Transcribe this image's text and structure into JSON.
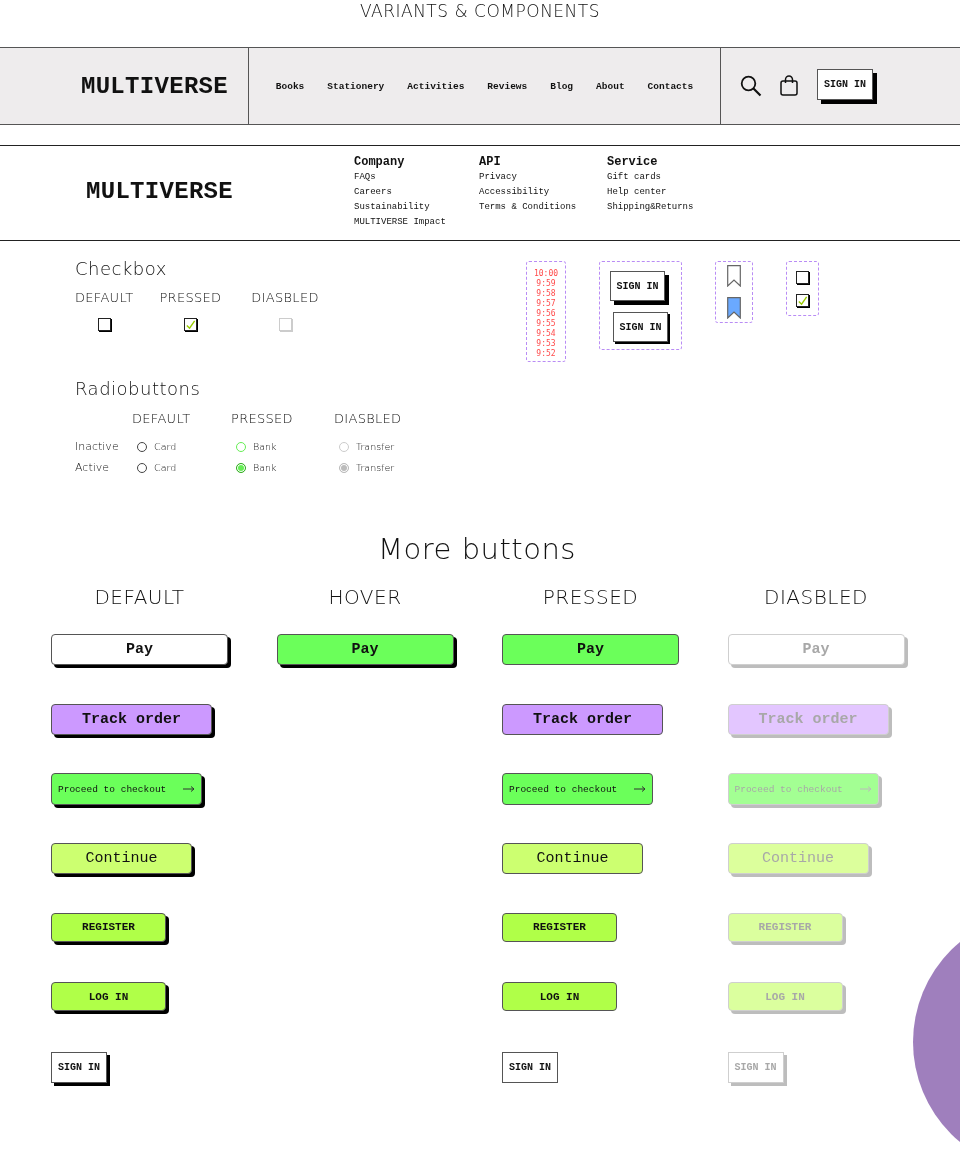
{
  "title": "VARIANTS & COMPONENTS",
  "header": {
    "logo": "MULTIVERSE",
    "nav": [
      "Books",
      "Stationery",
      "Activities",
      "Reviews",
      "Blog",
      "About",
      "Contacts"
    ],
    "sign_in": "SIGN IN"
  },
  "footer": {
    "logo": "MULTIVERSE",
    "columns": [
      {
        "heading": "Company",
        "links": [
          "FAQs",
          "Careers",
          "Sustainability",
          "MULTIVERSE Impact"
        ]
      },
      {
        "heading": "API",
        "links": [
          "Privacy",
          "Accessibility",
          "Terms & Conditions"
        ]
      },
      {
        "heading": "Service",
        "links": [
          "Gift cards",
          "Help center",
          "Shipping&Returns"
        ]
      }
    ]
  },
  "checkbox": {
    "title": "Checkbox",
    "states": [
      {
        "label": "DEFAULT",
        "checked": false,
        "disabled": false
      },
      {
        "label": "PRESSED",
        "checked": true,
        "disabled": false
      },
      {
        "label": "DIASBLED",
        "checked": false,
        "disabled": true
      }
    ]
  },
  "radio": {
    "title": "Radiobuttons",
    "columns": [
      "DEFAULT",
      "PRESSED",
      "DIASBLED"
    ],
    "rows": [
      {
        "label": "Inactive",
        "options": [
          {
            "text": "Card",
            "kind": "default",
            "selected": false
          },
          {
            "text": "Bank",
            "kind": "pressed",
            "selected": false
          },
          {
            "text": "Transfer",
            "kind": "disabled",
            "selected": false
          }
        ]
      },
      {
        "label": "Active",
        "options": [
          {
            "text": "Card",
            "kind": "default",
            "selected": false
          },
          {
            "text": "Bank",
            "kind": "pressed",
            "selected": true
          },
          {
            "text": "Transfer",
            "kind": "disabled",
            "selected": true
          }
        ]
      }
    ]
  },
  "samples": {
    "times": [
      "10:00",
      "9:59",
      "9:58",
      "9:57",
      "9:56",
      "9:55",
      "9:54",
      "9:53",
      "9:52"
    ],
    "sign_in_buttons": [
      {
        "label": "SIGN IN",
        "kind": "raised"
      },
      {
        "label": "SIGN IN",
        "kind": "flat"
      }
    ],
    "bookmarks": [
      {
        "selected": false
      },
      {
        "selected": true
      }
    ],
    "checkboxes": [
      {
        "checked": false
      },
      {
        "checked": true
      }
    ]
  },
  "more_buttons": {
    "title": "More buttons",
    "columns": [
      "DEFAULT",
      "HOVER",
      "PRESSED",
      "DIASBLED"
    ],
    "rows": [
      {
        "kind": "wide",
        "buttons": [
          {
            "label": "Pay",
            "color": "#ffffff",
            "kind": "default"
          },
          {
            "label": "Pay",
            "color": "#6bff5a",
            "kind": "hover"
          },
          {
            "label": "Pay",
            "color": "#6bff5a",
            "kind": "pressed"
          },
          {
            "label": "Pay",
            "color": "#ffffff",
            "kind": "disabled"
          }
        ]
      },
      {
        "kind": "medium",
        "buttons": [
          {
            "label": "Track order",
            "color": "#cc99ff",
            "kind": "default"
          },
          {
            "label": "Track order",
            "color": "#cc99ff",
            "kind": "pressed"
          },
          {
            "label": "Track order",
            "color": "#e3c6ff",
            "kind": "disabled"
          }
        ]
      },
      {
        "kind": "arrow",
        "buttons": [
          {
            "label": "Proceed to checkout",
            "color": "#6bff5a",
            "kind": "default"
          },
          {
            "label": "Proceed to checkout",
            "color": "#6bff5a",
            "kind": "pressed"
          },
          {
            "label": "Proceed to checkout",
            "color": "#a3ff93",
            "kind": "disabled"
          }
        ]
      },
      {
        "kind": "regular",
        "buttons": [
          {
            "label": "Continue",
            "color": "#ccff70",
            "kind": "default"
          },
          {
            "label": "Continue",
            "color": "#ccff70",
            "kind": "pressed"
          },
          {
            "label": "Continue",
            "color": "#dcff9c",
            "kind": "disabled"
          }
        ]
      },
      {
        "kind": "caps",
        "buttons": [
          {
            "label": "REGISTER",
            "color": "#b0ff48",
            "kind": "default"
          },
          {
            "label": "REGISTER",
            "color": "#b0ff48",
            "kind": "pressed"
          },
          {
            "label": "REGISTER",
            "color": "#dbff9e",
            "kind": "disabled"
          }
        ]
      },
      {
        "kind": "caps",
        "buttons": [
          {
            "label": "LOG IN",
            "color": "#b0ff48",
            "kind": "default"
          },
          {
            "label": "LOG IN",
            "color": "#b0ff48",
            "kind": "pressed"
          },
          {
            "label": "LOG IN",
            "color": "#dbff9e",
            "kind": "disabled"
          }
        ]
      },
      {
        "kind": "square",
        "buttons": [
          {
            "label": "SIGN IN",
            "color": "#ffffff",
            "kind": "default"
          },
          {
            "label": "SIGN IN",
            "color": "#ffffff",
            "kind": "pressed"
          },
          {
            "label": "SIGN IN",
            "color": "#ffffff",
            "kind": "disabled"
          }
        ]
      }
    ]
  }
}
